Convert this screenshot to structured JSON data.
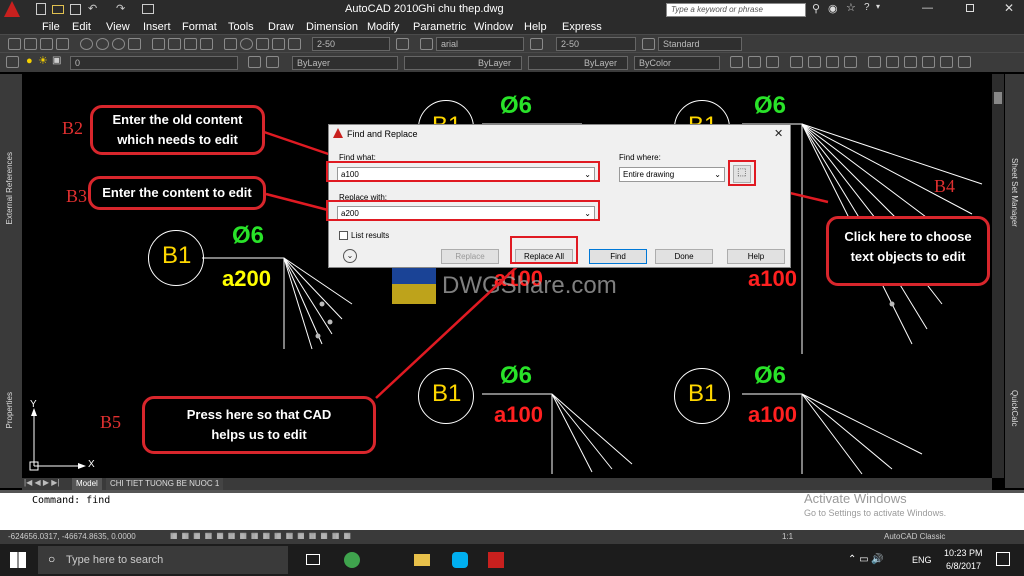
{
  "window": {
    "app_title": "AutoCAD 2010",
    "file_title": "Ghi chu thep.dwg",
    "search_placeholder": "Type a keyword or phrase"
  },
  "menu": [
    "File",
    "Edit",
    "View",
    "Insert",
    "Format",
    "Tools",
    "Draw",
    "Dimension",
    "Modify",
    "Parametric",
    "Window",
    "Help",
    "Express"
  ],
  "toolbar": {
    "dimstyle_1": "2-50",
    "text_style": "arial",
    "dimstyle_2": "2-50",
    "table_style": "Standard",
    "layer": "0",
    "color": "ByLayer",
    "linetype": "ByLayer",
    "lineweight": "ByLayer",
    "plotstyle": "ByColor"
  },
  "side_panels": {
    "left_top": "External References",
    "left_bottom": "Properties",
    "right_top": "Sheet Set Manager",
    "right_bottom": "QuickCalc"
  },
  "drawing": {
    "marker": "B1",
    "phi": "Ø6",
    "old_text": "a100",
    "new_text": "a200",
    "ucs_x": "X",
    "ucs_y": "Y",
    "watermark": "DWGShare.com"
  },
  "steps": {
    "b2": "B2",
    "b3": "B3",
    "b4": "B4",
    "b5": "B5"
  },
  "callouts": {
    "b2_text_1": "Enter the old content",
    "b2_text_2": "which needs to edit",
    "b3_text": "Enter the content to edit",
    "b4_text_1": "Click here to choose",
    "b4_text_2": "text objects to edit",
    "b5_text_1": "Press here so that CAD",
    "b5_text_2": "helps us to edit"
  },
  "dialog": {
    "title": "Find and Replace",
    "find_what_label": "Find what:",
    "find_what_value": "a100",
    "find_where_label": "Find where:",
    "find_where_value": "Entire drawing",
    "replace_with_label": "Replace with:",
    "replace_with_value": "a200",
    "list_results_label": "List results",
    "btn_replace": "Replace",
    "btn_replace_all": "Replace All",
    "btn_find": "Find",
    "btn_done": "Done",
    "btn_help": "Help"
  },
  "tabs": {
    "model": "Model",
    "layout": "CHI TIET TUONG BE NUOC 1"
  },
  "command": {
    "text": "Command: find"
  },
  "activate": {
    "line1": "Activate Windows",
    "line2": "Go to Settings to activate Windows."
  },
  "status": {
    "coords": "-624656.0317, -46674.8635, 0.0000",
    "scale": "1:1",
    "workspace": "AutoCAD Classic"
  },
  "taskbar": {
    "search_placeholder": "Type here to search",
    "lang": "ENG",
    "time": "10:23 PM",
    "date": "6/8/2017"
  }
}
